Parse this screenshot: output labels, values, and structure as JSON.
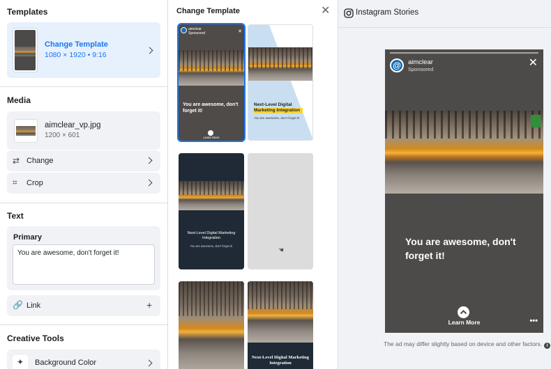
{
  "left": {
    "templates": {
      "title": "Templates",
      "card_title": "Change Template",
      "card_sub": "1080 × 1920 • 9:16"
    },
    "media": {
      "title": "Media",
      "file_name": "aimclear_vp.jpg",
      "file_dims": "1200 × 601",
      "change_label": "Change",
      "crop_label": "Crop"
    },
    "text": {
      "title": "Text",
      "primary_label": "Primary",
      "primary_value": "You are awesome, don't forget it!",
      "link_label": "Link"
    },
    "creative": {
      "title": "Creative Tools",
      "bg_label": "Background Color"
    }
  },
  "middle": {
    "title": "Change Template",
    "tiles": {
      "t1_name": "aimclear",
      "t1_spons": "Sponsored",
      "t1_text": "You are awesome, don't forget it!",
      "t1_cta": "Learn More",
      "t2_text": "Next-Level Digital Marketing Integration",
      "t2_sub": "You are awesome, don't forget it!",
      "t3_text": "Next-Level Digital Marketing Integration",
      "t3_sub": "You are awesome, don't forget it!",
      "t6_text": "Next-Level Digital Marketing Integration"
    }
  },
  "right": {
    "title": "Instagram Stories",
    "story": {
      "name": "aimclear",
      "sponsored": "Sponsored",
      "message": "You are awesome, don't forget it!",
      "cta": "Learn More",
      "more": "•••"
    },
    "disclaimer": "The ad may differ slightly based on device and other factors."
  },
  "colors": {
    "accent": "#1877f2",
    "selected_bg": "#e7f0fd"
  },
  "icons": [
    "chevron-right-icon",
    "swap-icon",
    "crop-icon",
    "link-icon",
    "plus-icon",
    "close-icon",
    "instagram-icon",
    "magic-wand-icon",
    "info-icon",
    "chevron-up-icon"
  ]
}
